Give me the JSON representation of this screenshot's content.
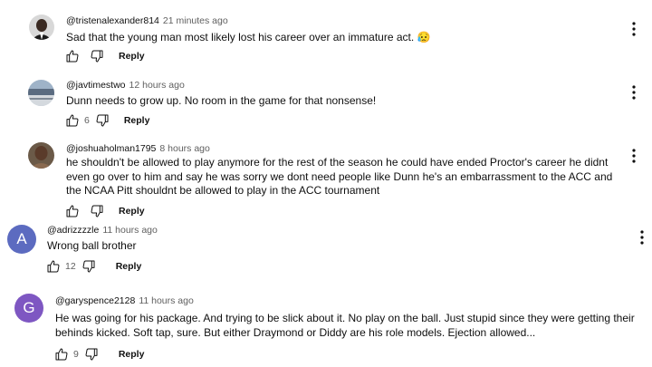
{
  "comments": [
    {
      "author": "@tristenalexander814",
      "time": "21 minutes ago",
      "text": "Sad that the young man most likely lost his career over an immature act. 😥",
      "likes": "",
      "reply_label": "Reply",
      "avatar_icon": "profile-photo"
    },
    {
      "author": "@javtimestwo",
      "time": "12 hours ago",
      "text": "Dunn needs to grow up. No room in the game for that nonsense!",
      "likes": "6",
      "reply_label": "Reply",
      "avatar_icon": "stadium-photo"
    },
    {
      "author": "@joshuaholman1795",
      "time": "8 hours ago",
      "text": "he shouldn't be allowed to play anymore for the rest of the season he could have ended Proctor's career he didnt even go over to him and say he was sorry we dont need people like  Dunn he's an embarrassment to the ACC and the NCAA Pitt shouldnt be allowed to play in the ACC tournament",
      "likes": "",
      "reply_label": "Reply",
      "avatar_icon": "profile-photo"
    },
    {
      "author": "@adrizzzzle",
      "time": "11 hours ago",
      "text": "Wrong ball brother",
      "likes": "12",
      "reply_label": "Reply",
      "avatar_letter": "A",
      "avatar_color": "#5c6bc0"
    },
    {
      "author": "@garyspence2128",
      "time": "11 hours ago",
      "text": "He was going for his package. And trying to be slick about it. No play on the ball. Just stupid since they were getting their behinds kicked. Soft tap, sure. But either Draymond or Diddy are his role models. Ejection allowed...",
      "likes": "9",
      "reply_label": "Reply",
      "avatar_letter": "G",
      "avatar_color": "#7e57c2"
    }
  ],
  "icons": {
    "like": "thumbs-up-icon",
    "dislike": "thumbs-down-icon",
    "menu": "more-vert-icon"
  }
}
